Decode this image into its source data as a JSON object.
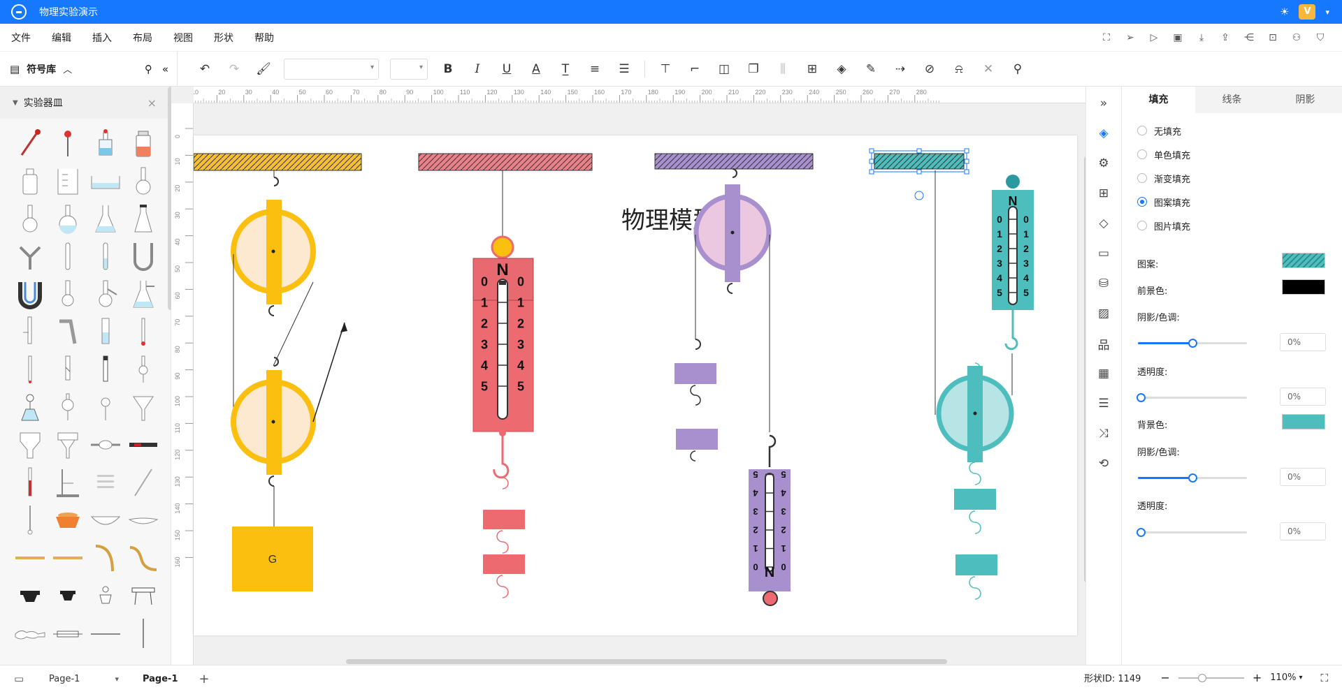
{
  "app": {
    "title": "物理实验演示"
  },
  "menu": [
    "文件",
    "编辑",
    "插入",
    "布局",
    "视图",
    "形状",
    "帮助"
  ],
  "symbol_library": {
    "label": "符号库",
    "category": "实验器皿"
  },
  "canvas": {
    "title_text": "物理模型",
    "weight_label": "G",
    "spring_scale": {
      "top_label": "N",
      "ticks": [
        "0",
        "1",
        "2",
        "3",
        "4",
        "5"
      ]
    },
    "ruler_top": [
      "10",
      "20",
      "30",
      "40",
      "50",
      "60",
      "70",
      "80",
      "90",
      "100",
      "110",
      "120",
      "130",
      "140",
      "150",
      "160",
      "170",
      "180",
      "190",
      "200",
      "210",
      "220",
      "230",
      "240",
      "250",
      "260",
      "270",
      "280"
    ],
    "ruler_left": [
      "0",
      "10",
      "20",
      "30",
      "40",
      "50",
      "60",
      "70",
      "80",
      "90",
      "100",
      "110",
      "120",
      "130",
      "140",
      "150",
      "160"
    ]
  },
  "panel": {
    "tabs": [
      "填充",
      "线条",
      "阴影"
    ],
    "fill_options": [
      "无填充",
      "单色填充",
      "渐变填充",
      "图案填充",
      "图片填充"
    ],
    "selected_fill": "图案填充",
    "pattern_label": "图案:",
    "foreground_label": "前景色:",
    "shade1_label": "阴影/色调:",
    "shade1_value": "0%",
    "transparency1_label": "透明度:",
    "transparency1_value": "0%",
    "background_label": "背景色:",
    "shade2_label": "阴影/色调:",
    "shade2_value": "0%",
    "transparency2_label": "透明度:",
    "transparency2_value": "0%",
    "colors": {
      "pattern": "#4dbdbd",
      "foreground": "#000000",
      "background": "#4dbdbd"
    }
  },
  "status": {
    "page_selector": "Page-1",
    "page_tab": "Page-1",
    "shape_id": "形状ID: 1149",
    "zoom": "110%"
  }
}
